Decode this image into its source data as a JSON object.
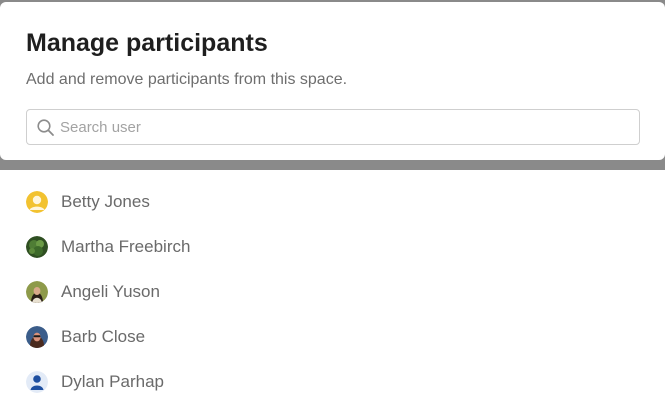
{
  "dialog": {
    "title": "Manage participants",
    "subtitle": "Add and remove participants from this space."
  },
  "search": {
    "placeholder": "Search user",
    "value": "",
    "icon": "search-icon"
  },
  "participants": [
    {
      "name": "Betty Jones",
      "avatar": "default-user-avatar",
      "avatar_color": "#f2c230"
    },
    {
      "name": "Martha Freebirch",
      "avatar": "photo-avatar",
      "avatar_color": "#3f6b2e"
    },
    {
      "name": "Angeli Yuson",
      "avatar": "photo-avatar",
      "avatar_color": "#7a8a3c"
    },
    {
      "name": "Barb Close",
      "avatar": "photo-avatar",
      "avatar_color": "#8a4a3a"
    },
    {
      "name": "Dylan Parhap",
      "avatar": "default-user-avatar",
      "avatar_color": "#1e4fa0"
    }
  ]
}
